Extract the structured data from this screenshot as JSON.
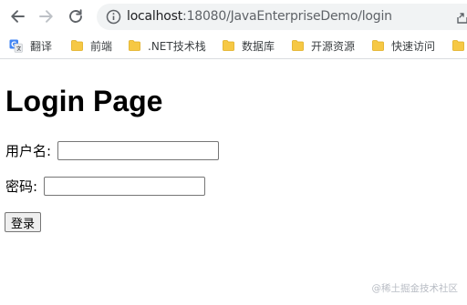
{
  "browser": {
    "address_bar": {
      "host": "localhost",
      "path": ":18080/JavaEnterpriseDemo/login"
    },
    "bookmarks": [
      {
        "label": "翻译",
        "icon": "translate-icon"
      },
      {
        "label": "前端",
        "icon": "folder-icon"
      },
      {
        "label": ".NET技术栈",
        "icon": "folder-icon"
      },
      {
        "label": "数据库",
        "icon": "folder-icon"
      },
      {
        "label": "开源资源",
        "icon": "folder-icon"
      },
      {
        "label": "快速访问",
        "icon": "folder-icon"
      }
    ]
  },
  "page": {
    "title": "Login Page",
    "form": {
      "username_label": "用户名:",
      "username_value": "",
      "password_label": "密码:",
      "password_value": "",
      "submit_label": "登录"
    }
  },
  "watermark": "@稀土掘金技术社区",
  "colors": {
    "omnibox_bg": "#f1f3f4",
    "folder_yellow": "#f6c844",
    "translate_blue": "#4285f4"
  }
}
